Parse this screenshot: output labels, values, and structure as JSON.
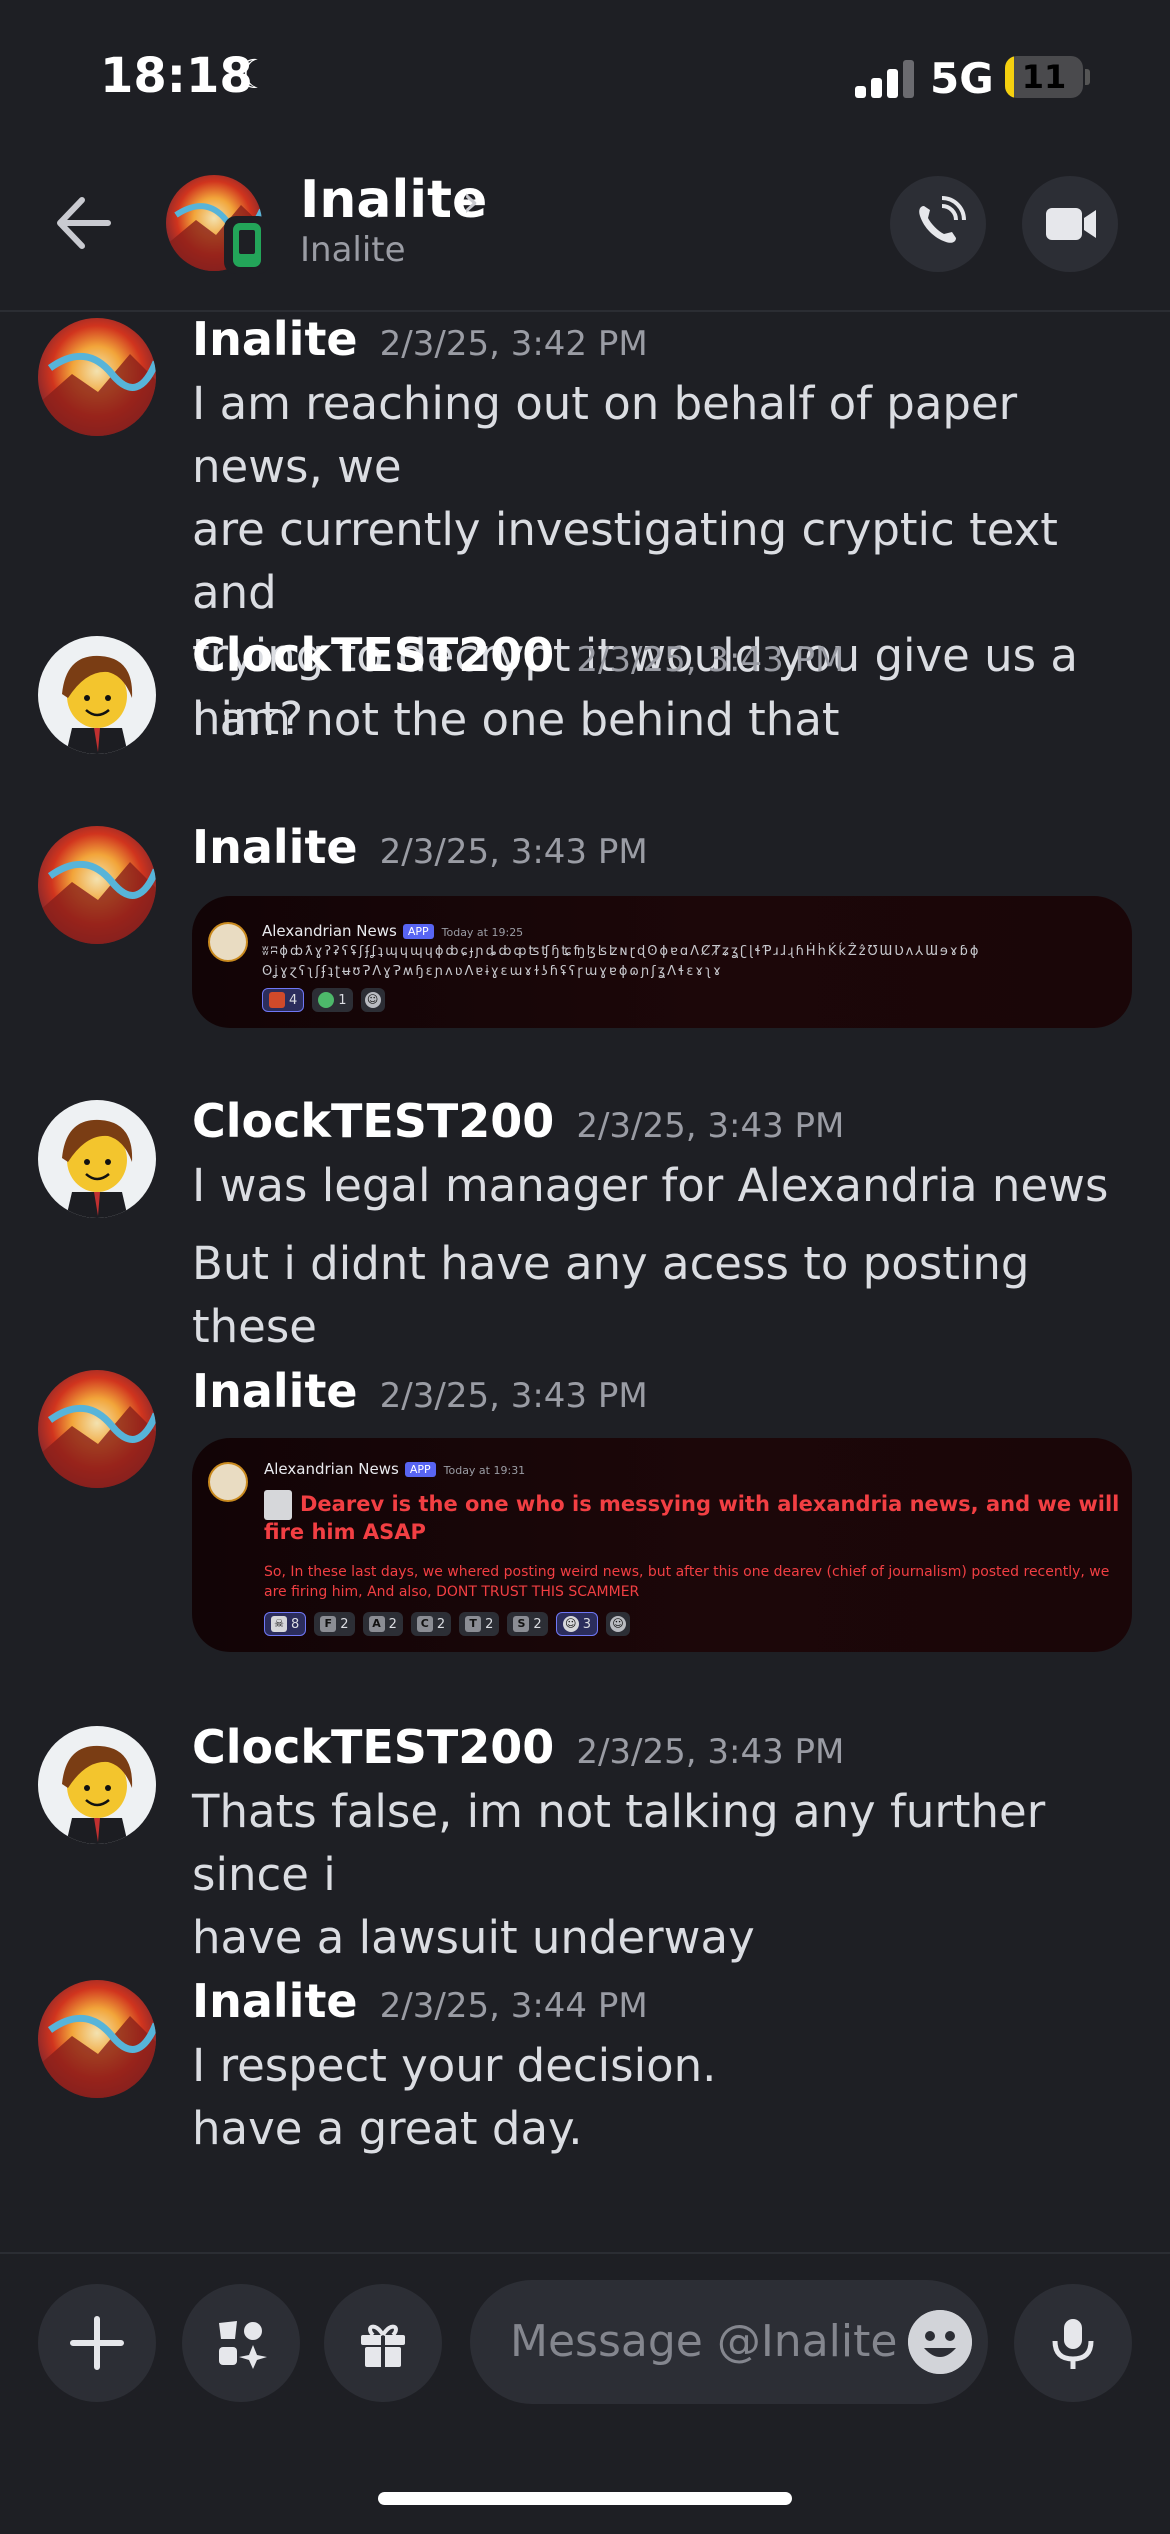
{
  "status_bar": {
    "time": "18:18",
    "network": "5G",
    "battery": "11",
    "battery_level": 0.11
  },
  "header": {
    "name": "Inalite",
    "subtitle": "Inalite"
  },
  "messages": [
    {
      "author": "Inalite",
      "timestamp": "2/3/25, 3:42 PM",
      "lines": [
        "I am reaching out on behalf of paper news, we",
        "are currently investigating cryptic text and",
        "trying to decrypt it would you give us a hint?"
      ]
    },
    {
      "author": "ClockTEST200",
      "timestamp": "2/3/25, 3:43 PM",
      "lines": [
        "I am not the one behind that"
      ]
    },
    {
      "author": "Inalite",
      "timestamp": "2/3/25, 3:43 PM",
      "embed": {
        "title": "Alexandrian News",
        "app_badge": "APP",
        "time": "Today at 19:25",
        "line1": "ʬʭɸȸƛɣʔʡʕʢʃʄʆʇɰɥɰɥɸȸɕɟɲȡȸȹʦʧɧʨʩɮʪʫɴɽɖʘɸɐɑɅȻȾʑʓʗɭɬƤɹɺɻɦḢḣḰḱẐẑƱƜƲʌ⅄Ɯɘɤɓɸ",
        "line2": "ʘʝɣɀʕʅʃʄʇʈʉʊɁɅɣɁʍɧɛɲʌʋɅɐɨɣɛɯɤɫʖɦʢʕɼɯɣɐɸɷɲʃʓɅɬɛɤʅɤ",
        "reactions": [
          {
            "count": "4"
          },
          {
            "count": "1"
          }
        ]
      }
    },
    {
      "author": "ClockTEST200",
      "timestamp": "2/3/25, 3:43 PM",
      "lines": [
        "I was legal manager for Alexandria news"
      ],
      "extra_lines": [
        "But i didnt have any acess to posting these"
      ]
    },
    {
      "author": "Inalite",
      "timestamp": "2/3/25, 3:43 PM",
      "embed": {
        "title": "Alexandrian News",
        "app_badge": "APP",
        "time": "Today at 19:31",
        "headline": "Dearev is the one who is messying with alexandria news, and we will fire him ASAP",
        "body": "So, In these last days, we whered posting weird news, but after this one dearev (chief of journalism) posted recently, we are firing him, And also, DONT TRUST THIS SCAMMER",
        "reactions": [
          {
            "glyph": "☠",
            "count": "8"
          },
          {
            "glyph": "F",
            "count": "2"
          },
          {
            "glyph": "A",
            "count": "2"
          },
          {
            "glyph": "C",
            "count": "2"
          },
          {
            "glyph": "T",
            "count": "2"
          },
          {
            "glyph": "S",
            "count": "2"
          },
          {
            "glyph": "☺",
            "count": "3"
          }
        ]
      }
    },
    {
      "author": "ClockTEST200",
      "timestamp": "2/3/25, 3:43 PM",
      "lines": [
        "Thats false, im not talking any further since i",
        "have a lawsuit underway"
      ]
    },
    {
      "author": "Inalite",
      "timestamp": "2/3/25, 3:44 PM",
      "lines": [
        "I respect your decision.",
        "have a great day."
      ]
    }
  ],
  "composer": {
    "placeholder": "Message @Inalite"
  },
  "icons": [
    "back-arrow-icon",
    "mobile-icon",
    "phone-call-icon",
    "video-camera-icon",
    "plus-icon",
    "apps-icon",
    "gift-icon",
    "emoji-icon",
    "microphone-icon"
  ],
  "colors": {
    "background": "#1e1f24",
    "accent": "#5865f2",
    "danger": "#f23f43",
    "online": "#23a559"
  }
}
